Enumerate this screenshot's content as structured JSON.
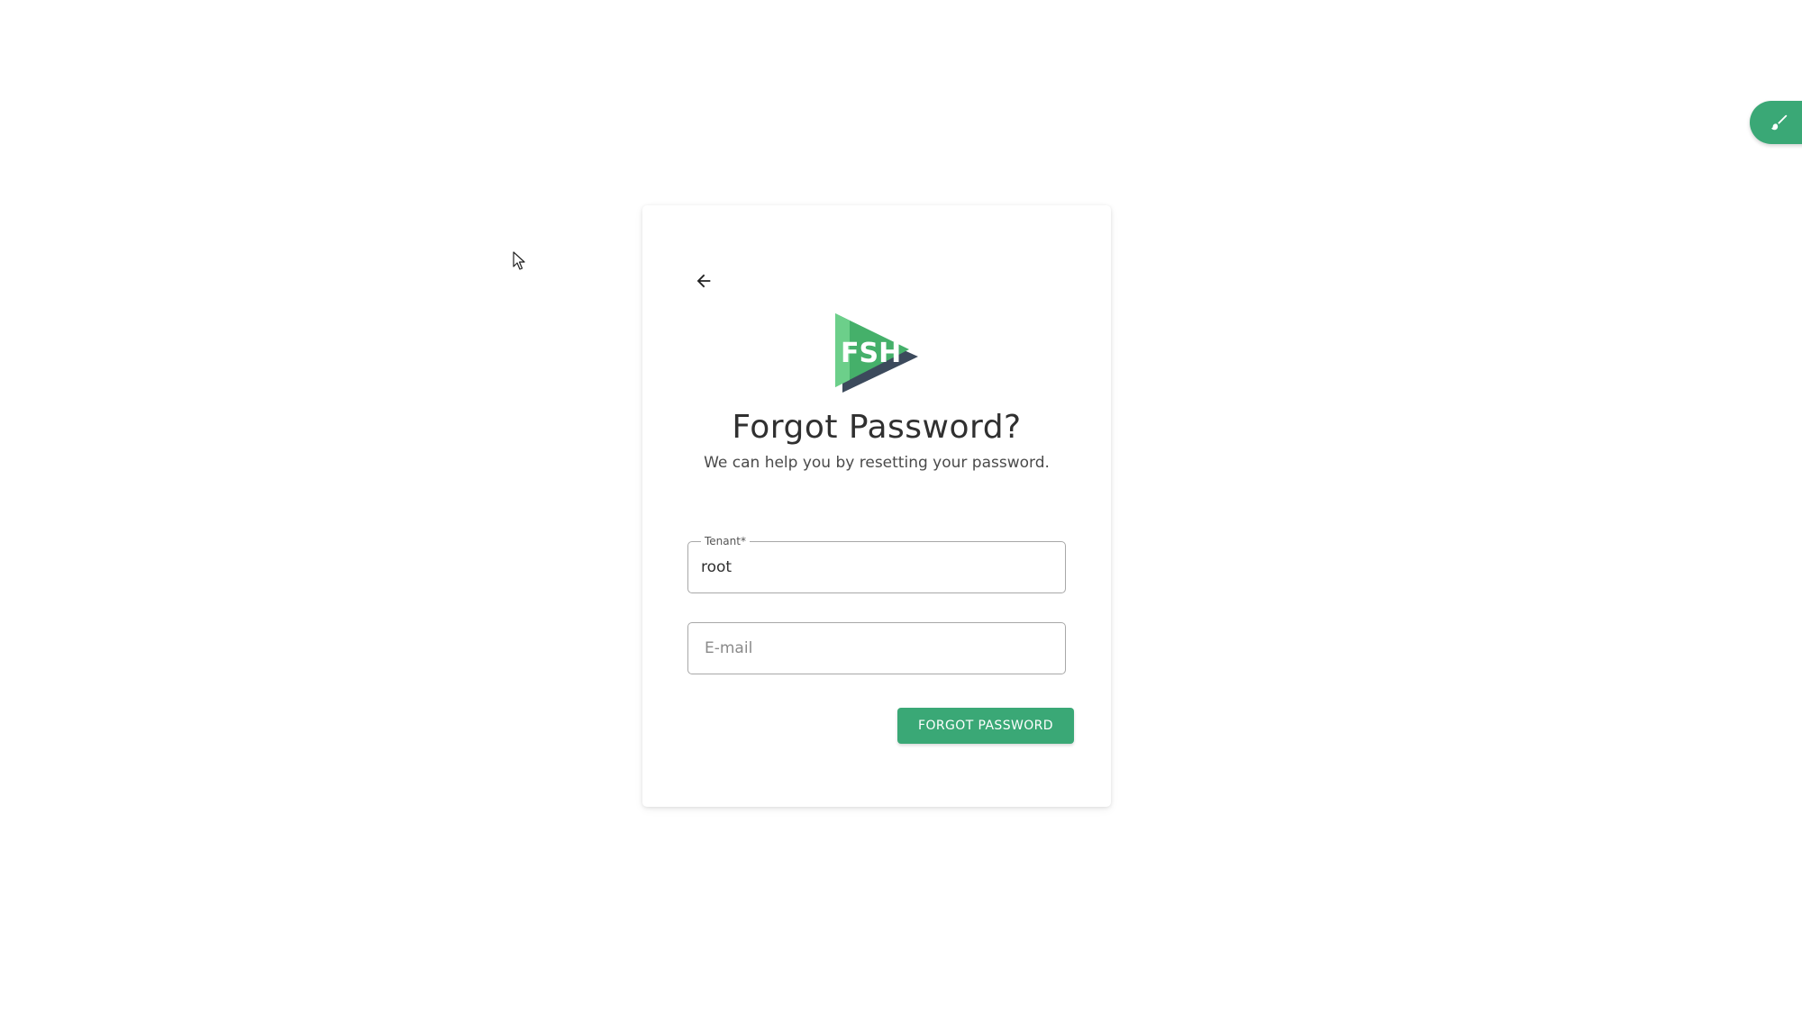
{
  "colors": {
    "accent": "#3aa876",
    "text": "#303030",
    "border": "#a8a8a8",
    "background": "#ffffff"
  },
  "icons": {
    "back": "arrow-left-icon",
    "logo": "fsh-logo",
    "theme": "paintbrush-icon",
    "cursor": "mouse-pointer"
  },
  "logo": {
    "text": "FSH"
  },
  "header": {
    "title": "Forgot Password?",
    "subtitle": "We can help you by resetting your password."
  },
  "form": {
    "tenant": {
      "label": "Tenant*",
      "value": "root"
    },
    "email": {
      "placeholder": "E-mail",
      "value": ""
    },
    "submit_label": "FORGOT PASSWORD"
  }
}
